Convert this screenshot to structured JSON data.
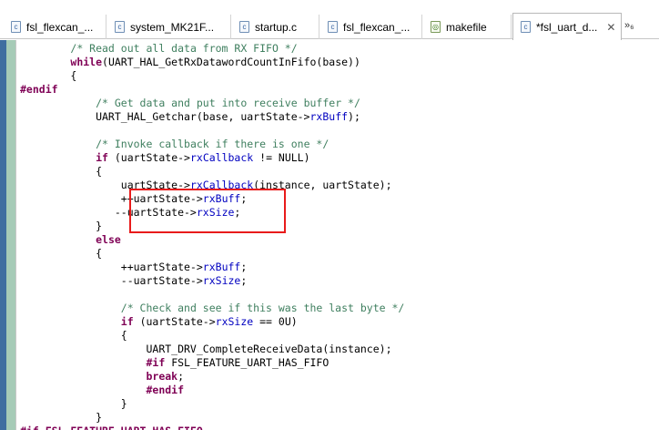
{
  "tabs": [
    {
      "label": "fsl_flexcan_...",
      "icon": "c-file-icon",
      "active": false
    },
    {
      "label": "system_MK21F...",
      "icon": "c-file-icon",
      "active": false
    },
    {
      "label": "startup.c",
      "icon": "c-file-icon",
      "active": false
    },
    {
      "label": "fsl_flexcan_...",
      "icon": "c-file-icon",
      "active": false
    },
    {
      "label": "makefile",
      "icon": "makefile-icon",
      "active": false
    },
    {
      "label": "*fsl_uart_d...",
      "icon": "c-file-icon",
      "active": true
    }
  ],
  "tab_close": "✕",
  "tab_overflow": "»₆",
  "code_lines": [
    [
      {
        "t": "        "
      },
      {
        "t": "/* Read out all data from RX FIFO */",
        "c": "cm"
      }
    ],
    [
      {
        "t": "        "
      },
      {
        "t": "while",
        "c": "kw"
      },
      {
        "t": "(UART_HAL_GetRxDatawordCountInFifo(base))"
      }
    ],
    [
      {
        "t": "        {"
      }
    ],
    [
      {
        "t": "#endif",
        "c": "pp"
      }
    ],
    [
      {
        "t": "            "
      },
      {
        "t": "/* Get data and put into receive buffer */",
        "c": "cm"
      }
    ],
    [
      {
        "t": "            UART_HAL_Getchar(base, uartState->"
      },
      {
        "t": "rxBuff",
        "c": "fld"
      },
      {
        "t": ");"
      }
    ],
    [
      {
        "t": ""
      }
    ],
    [
      {
        "t": "            "
      },
      {
        "t": "/* Invoke callback if there is one */",
        "c": "cm"
      }
    ],
    [
      {
        "t": "            "
      },
      {
        "t": "if",
        "c": "kw"
      },
      {
        "t": " (uartState->"
      },
      {
        "t": "rxCallback",
        "c": "fld"
      },
      {
        "t": " != NULL)"
      }
    ],
    [
      {
        "t": "            {"
      }
    ],
    [
      {
        "t": "                uartState->"
      },
      {
        "t": "rxCallback",
        "c": "fld"
      },
      {
        "t": "(instance, uartState);"
      }
    ],
    [
      {
        "t": "                ++uartState->"
      },
      {
        "t": "rxBuff",
        "c": "fld"
      },
      {
        "t": ";"
      }
    ],
    [
      {
        "t": "               --uartState->"
      },
      {
        "t": "rxSize",
        "c": "fld"
      },
      {
        "t": ";"
      }
    ],
    [
      {
        "t": "            }"
      }
    ],
    [
      {
        "t": "            "
      },
      {
        "t": "else",
        "c": "kw"
      }
    ],
    [
      {
        "t": "            {"
      }
    ],
    [
      {
        "t": "                ++uartState->"
      },
      {
        "t": "rxBuff",
        "c": "fld"
      },
      {
        "t": ";"
      }
    ],
    [
      {
        "t": "                --uartState->"
      },
      {
        "t": "rxSize",
        "c": "fld"
      },
      {
        "t": ";"
      }
    ],
    [
      {
        "t": ""
      }
    ],
    [
      {
        "t": "                "
      },
      {
        "t": "/* Check and see if this was the last byte */",
        "c": "cm"
      }
    ],
    [
      {
        "t": "                "
      },
      {
        "t": "if",
        "c": "kw"
      },
      {
        "t": " (uartState->"
      },
      {
        "t": "rxSize",
        "c": "fld"
      },
      {
        "t": " == 0U)"
      }
    ],
    [
      {
        "t": "                {"
      }
    ],
    [
      {
        "t": "                    UART_DRV_CompleteReceiveData(instance);"
      }
    ],
    [
      {
        "t": "                    "
      },
      {
        "t": "#if",
        "c": "pp"
      },
      {
        "t": " FSL_FEATURE_UART_HAS_FIFO"
      }
    ],
    [
      {
        "t": "                    "
      },
      {
        "t": "break",
        "c": "kw"
      },
      {
        "t": ";"
      }
    ],
    [
      {
        "t": "                    "
      },
      {
        "t": "#endif",
        "c": "pp"
      }
    ],
    [
      {
        "t": "                }"
      }
    ],
    [
      {
        "t": "            }"
      }
    ],
    [
      {
        "t": "#if FSL_FEATURE_UART_HAS_FIFO",
        "c": "pp"
      }
    ]
  ],
  "colors": {
    "comment": "#3f7f5f",
    "keyword": "#7f0055",
    "field": "#0000c0",
    "highlight_box": "#e81b1b",
    "gutter": "#3f6ea0"
  }
}
